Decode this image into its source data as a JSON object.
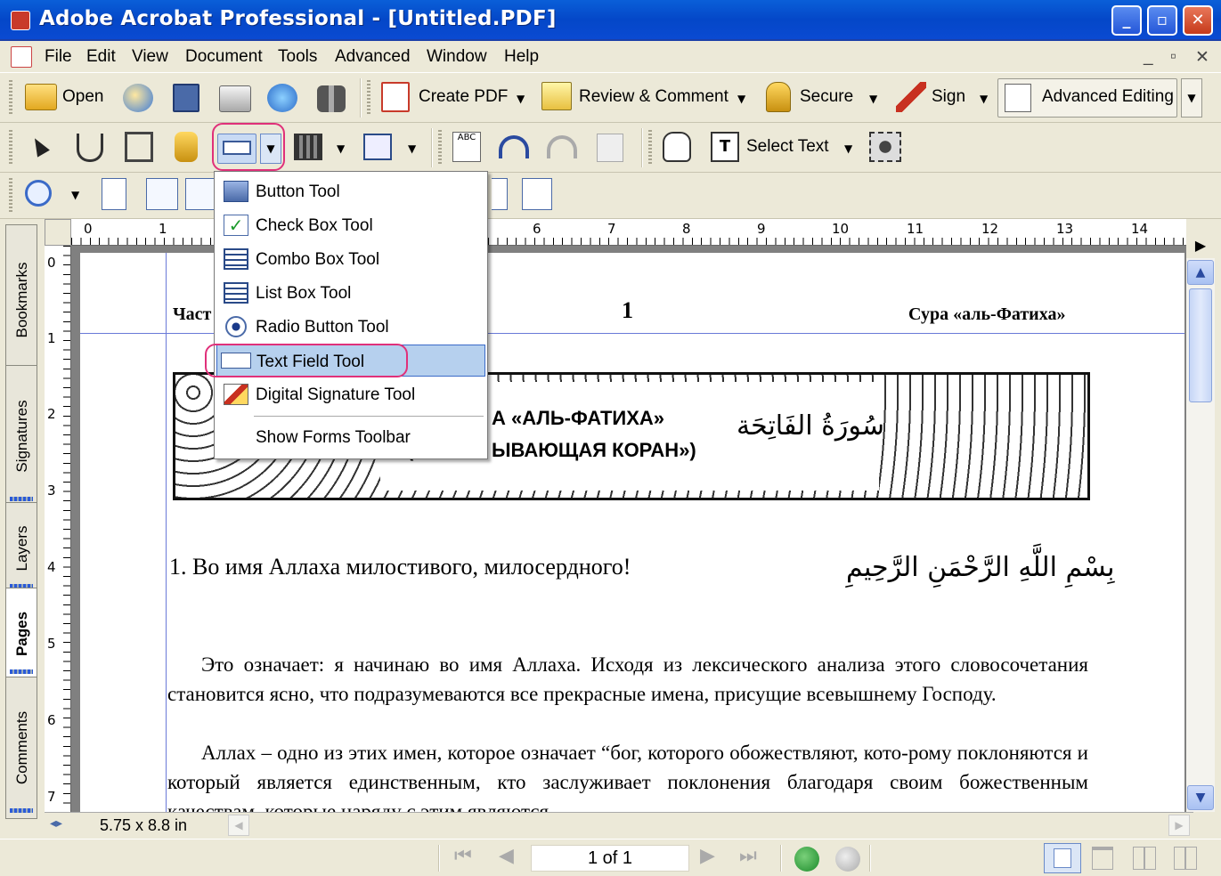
{
  "window": {
    "title": "Adobe Acrobat Professional - [Untitled.PDF]",
    "min": "_",
    "max": "▫",
    "close": "✕"
  },
  "menubar": {
    "items": [
      "File",
      "Edit",
      "View",
      "Document",
      "Tools",
      "Advanced",
      "Window",
      "Help"
    ],
    "doc_controls": [
      "_",
      "▫",
      "✕"
    ]
  },
  "toolbar1": {
    "open": "Open",
    "create_pdf": "Create PDF",
    "review": "Review & Comment",
    "secure": "Secure",
    "sign": "Sign",
    "advanced_editing": "Advanced Editing"
  },
  "toolbar2": {
    "select_text": "Select Text"
  },
  "menu": {
    "items": [
      "Button Tool",
      "Check Box Tool",
      "Combo Box Tool",
      "List Box Tool",
      "Radio Button Tool",
      "Text Field Tool",
      "Digital Signature Tool"
    ],
    "footer": "Show Forms Toolbar",
    "selected_index": 5
  },
  "sidebar": {
    "tabs": [
      "Bookmarks",
      "Signatures",
      "Layers",
      "Pages",
      "Comments"
    ]
  },
  "ruler": {
    "h": [
      "0",
      "1",
      "6",
      "7",
      "8",
      "9",
      "10",
      "11",
      "12",
      "13",
      "14"
    ],
    "v": [
      "0",
      "1",
      "2",
      "3",
      "4",
      "5",
      "6",
      "7"
    ]
  },
  "page": {
    "header_left": "Част",
    "header_num": "1",
    "header_right": "Сура «аль-Фатиха»",
    "banner_line1": "А «АЛЬ-ФАТИХА»",
    "banner_line2": "ЫВАЮЩАЯ КОРАН»)",
    "banner_paren": "(",
    "banner_arabic": "سُورَةُ الفَاتِحَة",
    "verse_title": "1. Во имя Аллаха милостивого, милосердного!",
    "verse_arabic": "بِسْمِ اللَّهِ الرَّحْمَنِ الرَّحِيمِ",
    "para1": "Это означает: я начинаю во имя Аллаха. Исходя из лексического анализа этого словосочетания становится ясно, что подразумеваются все прекрасные имена, присущие всевышнему Господу.",
    "para2": "Аллах – одно из этих имен, которое означает “бог, которого обожествляют, кото-рому поклоняются и который является единственным, кто заслуживает поклонения благодаря своим божественным качествам, которые наряду с этим являются"
  },
  "page_size": "5.75 x 8.8 in",
  "status": {
    "page": "1 of 1"
  },
  "colors": {
    "accent": "#0a5fd8",
    "highlight": "#e0307a",
    "selection": "#b6d0ee"
  }
}
